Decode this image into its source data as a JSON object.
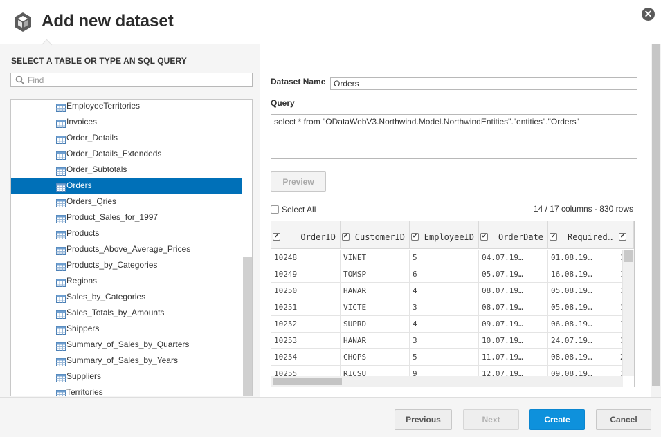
{
  "header": {
    "title": "Add new dataset",
    "logo_icon": "cube-logo-icon",
    "close_icon": "close-icon",
    "close_glyph": "✕"
  },
  "left": {
    "section_title": "SELECT A TABLE OR TYPE AN SQL QUERY",
    "search_placeholder": "Find",
    "tables": [
      {
        "label": "EmployeeTerritories",
        "selected": false
      },
      {
        "label": "Invoices",
        "selected": false
      },
      {
        "label": "Order_Details",
        "selected": false
      },
      {
        "label": "Order_Details_Extendeds",
        "selected": false
      },
      {
        "label": "Order_Subtotals",
        "selected": false
      },
      {
        "label": "Orders",
        "selected": true
      },
      {
        "label": "Orders_Qries",
        "selected": false
      },
      {
        "label": "Product_Sales_for_1997",
        "selected": false
      },
      {
        "label": "Products",
        "selected": false
      },
      {
        "label": "Products_Above_Average_Prices",
        "selected": false
      },
      {
        "label": "Products_by_Categories",
        "selected": false
      },
      {
        "label": "Regions",
        "selected": false
      },
      {
        "label": "Sales_by_Categories",
        "selected": false
      },
      {
        "label": "Sales_Totals_by_Amounts",
        "selected": false
      },
      {
        "label": "Shippers",
        "selected": false
      },
      {
        "label": "Summary_of_Sales_by_Quarters",
        "selected": false
      },
      {
        "label": "Summary_of_Sales_by_Years",
        "selected": false
      },
      {
        "label": "Suppliers",
        "selected": false
      },
      {
        "label": "Territories",
        "selected": false
      }
    ]
  },
  "right": {
    "dataset_name_label": "Dataset Name",
    "dataset_name_value": "Orders",
    "query_label": "Query",
    "query_value": "select * from \"ODataWebV3.Northwind.Model.NorthwindEntities\".\"entities\".\"Orders\"",
    "preview_label": "Preview",
    "select_all_label": "Select All",
    "column_info": "14 / 17 columns - 830 rows",
    "grid": {
      "columns": [
        "OrderID",
        "CustomerID",
        "EmployeeID",
        "OrderDate",
        "Required…"
      ],
      "check_glyph": "✔",
      "rows": [
        [
          "10248",
          "VINET",
          "5",
          "04.07.19…",
          "01.08.19…",
          "1"
        ],
        [
          "10249",
          "TOMSP",
          "6",
          "05.07.19…",
          "16.08.19…",
          "1"
        ],
        [
          "10250",
          "HANAR",
          "4",
          "08.07.19…",
          "05.08.19…",
          "1"
        ],
        [
          "10251",
          "VICTE",
          "3",
          "08.07.19…",
          "05.08.19…",
          "1"
        ],
        [
          "10252",
          "SUPRD",
          "4",
          "09.07.19…",
          "06.08.19…",
          "1"
        ],
        [
          "10253",
          "HANAR",
          "3",
          "10.07.19…",
          "24.07.19…",
          "1"
        ],
        [
          "10254",
          "CHOPS",
          "5",
          "11.07.19…",
          "08.08.19…",
          "2"
        ],
        [
          "10255",
          "RICSU",
          "9",
          "12.07.19…",
          "09.08.19…",
          "1"
        ]
      ]
    }
  },
  "footer": {
    "previous_label": "Previous",
    "next_label": "Next",
    "create_label": "Create",
    "cancel_label": "Cancel"
  },
  "colors": {
    "accent": "#0e91dc",
    "selection": "#0070b8"
  }
}
